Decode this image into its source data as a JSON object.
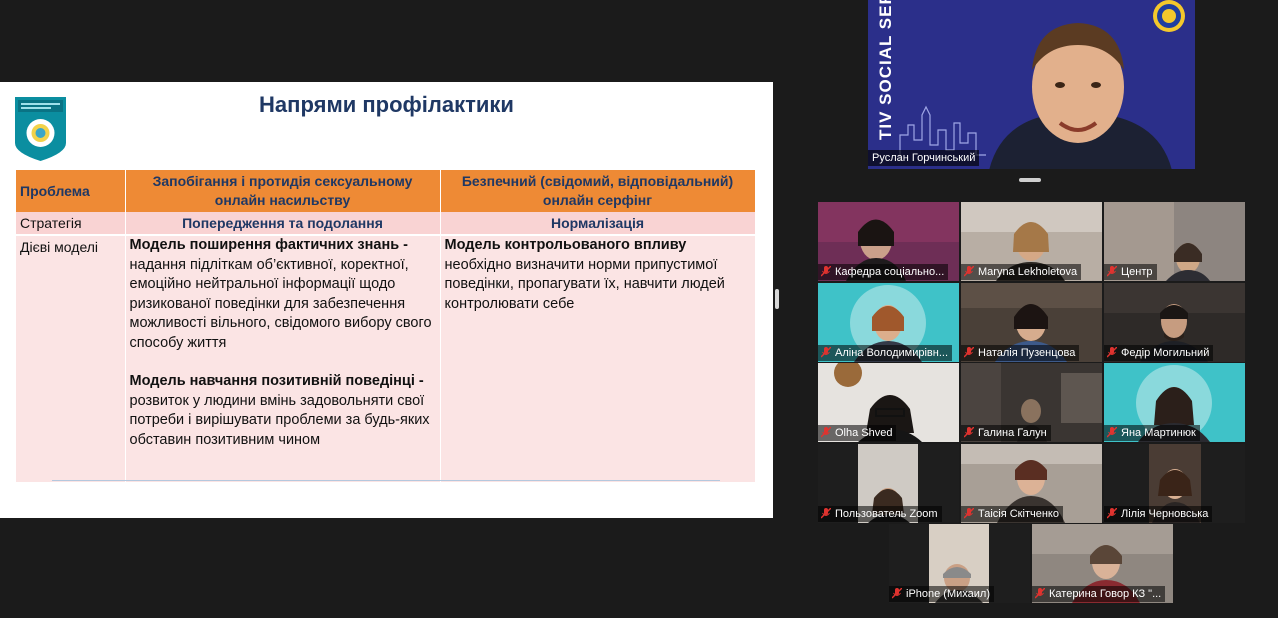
{
  "slide": {
    "title": "Напрями профілактики",
    "table": {
      "col1_header": "Проблема",
      "col2_header": "Запобігання і протидія сексуальному онлайн насильству",
      "col3_header": "Безпечний (свідомий, відповідальний) онлайн серфінг",
      "strategy_label": "Стратегія",
      "strategy_col2": "Попередження та подолання",
      "strategy_col3": "Нормалізація",
      "models_label": "Дієві моделі",
      "model1_title": "Модель  поширення фактичних знань -",
      "model1_text": "надання підліткам об’єктивної, коректної, емоційно нейтральної інформації щодо ризикованої поведінки для забезпечення можливості вільного, свідомого вибору свого способу життя",
      "model2_title": "Модель навчання позитивній поведінці -",
      "model2_text": "розвиток у людини вмінь задовольняти свої потреби і вирішувати проблеми за будь-яких обставин позитивним чином",
      "model3_title": "Модель контрольованого впливу",
      "model3_text": "необхідно визначити норми припустимої поведінки, пропагувати їх, навчити людей контролювати себе"
    }
  },
  "speaker": {
    "name": "Руслан Горчинський",
    "banner_text": "TIV SOCIAL SERVICE"
  },
  "participants": [
    {
      "name": "Кафедра соціально...",
      "muted": true
    },
    {
      "name": "Maryna Lekholetova",
      "muted": true
    },
    {
      "name": "Центр",
      "muted": true
    },
    {
      "name": "Аліна Володимирівн...",
      "muted": true
    },
    {
      "name": "Наталія Пузенцова",
      "muted": true
    },
    {
      "name": "Федір Могильний",
      "muted": true
    },
    {
      "name": "Olha Shved",
      "muted": true
    },
    {
      "name": "Галина Галун",
      "muted": true
    },
    {
      "name": "Яна Мартинюк",
      "muted": true
    },
    {
      "name": "Пользователь Zoom",
      "muted": true
    },
    {
      "name": "Таісія Скітченко",
      "muted": true
    },
    {
      "name": "Лілія Черновська",
      "muted": true
    },
    {
      "name": "iPhone (Михаил)",
      "muted": true
    },
    {
      "name": "Катерина Говор КЗ \"...",
      "muted": true
    }
  ],
  "colors": {
    "header_orange": "#ee8a35",
    "row_pink": "#fbe4e4",
    "title_blue": "#1f3864",
    "mute_red": "#e0332f"
  },
  "icons": {
    "mic_muted": "mic-muted-icon"
  }
}
